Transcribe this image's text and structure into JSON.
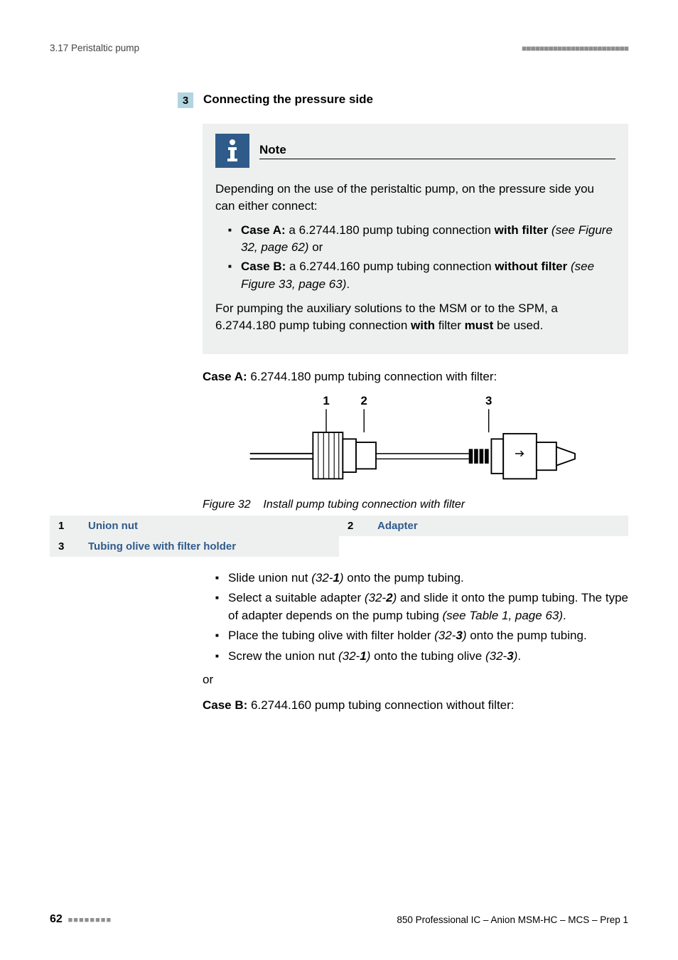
{
  "header": {
    "section": "3.17 Peristaltic pump",
    "squares": "■■■■■■■■■■■■■■■■■■■■■■■■"
  },
  "step": {
    "num": "3",
    "title": "Connecting the pressure side"
  },
  "note": {
    "label": "Note",
    "intro": "Depending on the use of the peristaltic pump, on the pressure side you can either connect:",
    "caseA_label": "Case A:",
    "caseA_text": " a 6.2744.180 pump tubing connection ",
    "caseA_bold": "with filter",
    "caseA_ref": "(see Figure 32, page 62)",
    "caseA_or": " or",
    "caseB_label": "Case B:",
    "caseB_text": " a 6.2744.160 pump tubing connection ",
    "caseB_bold": "without filter",
    "caseB_ref": "(see Figure 33, page 63)",
    "caseB_end": ".",
    "outro1": "For pumping the auxiliary solutions to the MSM or to the SPM, a 6.2744.180 pump tubing connection ",
    "outro_b1": "with",
    "outro_mid": " filter ",
    "outro_b2": "must",
    "outro_end": " be used."
  },
  "caseA_heading_b": "Case A:",
  "caseA_heading_rest": " 6.2744.180 pump tubing connection with filter:",
  "figure": {
    "lab1": "1",
    "lab2": "2",
    "lab3": "3",
    "caption_pre": "Figure 32",
    "caption_text": "Install pump tubing connection with filter"
  },
  "legend": {
    "n1": "1",
    "t1": "Union nut",
    "n2": "2",
    "t2": "Adapter",
    "n3": "3",
    "t3": "Tubing olive with filter holder"
  },
  "steps": {
    "s1a": "Slide union nut ",
    "s1ref": "(32-",
    "s1b": "1",
    "s1c": ")",
    "s1d": " onto the pump tubing.",
    "s2a": "Select a suitable adapter ",
    "s2ref": "(32-",
    "s2b": "2",
    "s2c": ")",
    "s2d": " and slide it onto the pump tubing. The type of adapter depends on the pump tubing ",
    "s2e": "(see Table 1, page 63)",
    "s2f": ".",
    "s3a": "Place the tubing olive with filter holder ",
    "s3ref": "(32-",
    "s3b": "3",
    "s3c": ")",
    "s3d": " onto the pump tubing.",
    "s4a": "Screw the union nut ",
    "s4ref1": "(32-",
    "s4b": "1",
    "s4c": ")",
    "s4d": " onto the tubing olive ",
    "s4ref2": "(32-",
    "s4e": "3",
    "s4f": ")",
    "s4g": "."
  },
  "or": "or",
  "caseB_heading_b": "Case B:",
  "caseB_heading_rest": " 6.2744.160 pump tubing connection without filter:",
  "footer": {
    "page": "62",
    "squares": "■ ■ ■ ■ ■ ■ ■ ■",
    "product": "850 Professional IC – Anion MSM-HC – MCS – Prep 1"
  }
}
